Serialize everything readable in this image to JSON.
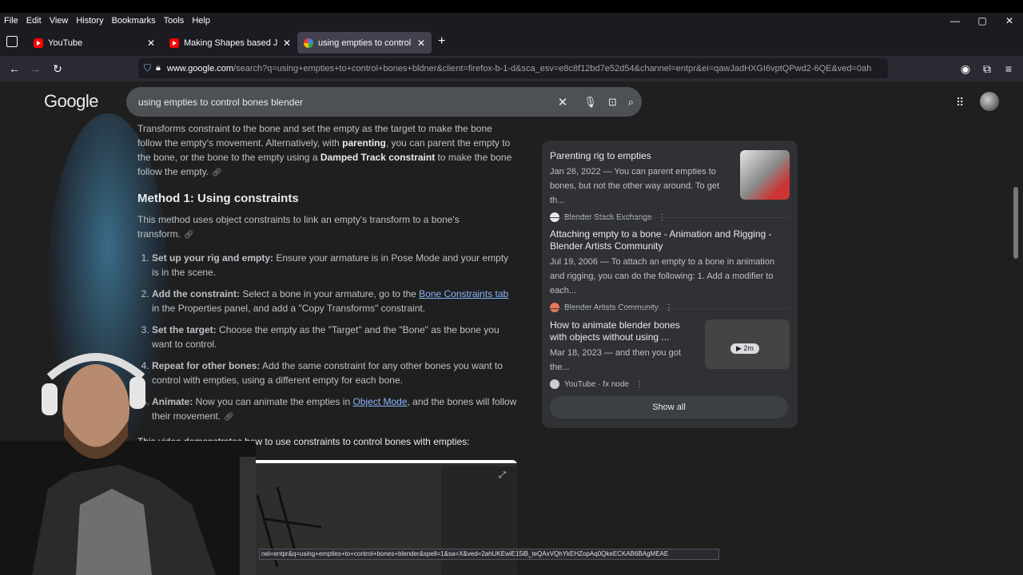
{
  "menubar": {
    "items": [
      "File",
      "Edit",
      "View",
      "History",
      "Bookmarks",
      "Tools",
      "Help"
    ]
  },
  "window_controls": [
    "—",
    "▢",
    "✕"
  ],
  "tabs": [
    {
      "label": "YouTube",
      "icon": "youtube-icon",
      "active": false
    },
    {
      "label": "Making Shapes based JIGGLE C",
      "icon": "youtube-icon",
      "active": false
    },
    {
      "label": "using empties to control bones",
      "icon": "google-icon",
      "active": true
    }
  ],
  "new_tab_label": "+",
  "address": {
    "domain": "www.google.com",
    "path": "/search?q=using+empties+to+control+bones+bldner&client=firefox-b-1-d&sca_esv=e8c8f12bd7e52d54&channel=entpr&ei=qawJadHXGI6vptQPwd2-6QE&ved=0ah"
  },
  "google": {
    "logo": "Google",
    "query": "using empties to control bones blender"
  },
  "article": {
    "p1_a": "Transforms constraint to the bone and set the empty as the target to make the bone follow the empty's movement. Alternatively, with ",
    "p1_b": "parenting",
    "p1_c": ", you can parent the empty to the bone, or the bone to the empty using a ",
    "p1_d": "Damped Track constraint",
    "p1_e": " to make the bone follow the empty.",
    "heading": "Method 1: Using constraints",
    "p2": "This method uses object constraints to link an empty's transform to a bone's transform.",
    "steps": [
      {
        "b": "Set up your rig and empty:",
        "t": " Ensure your armature is in Pose Mode and your empty is in the scene."
      },
      {
        "b": "Add the constraint:",
        "t1": " Select a bone in your armature, go to the ",
        "link": "Bone Constraints tab",
        "t2": " in the Properties panel, and add a \"Copy Transforms\" constraint."
      },
      {
        "b": "Set the target:",
        "t": " Choose the empty as the \"Target\" and the \"Bone\" as the bone you want to control."
      },
      {
        "b": "Repeat for other bones:",
        "t": " Add the same constraint for any other bones you want to control with empties, using a different empty for each bone."
      },
      {
        "b": "Animate:",
        "t1": " Now you can animate the empties in ",
        "link": "Object Mode",
        "t2": ", and the bones will follow their movement."
      }
    ],
    "video_caption": "This video demonstrates how to use constraints to control bones with empties:"
  },
  "sources": [
    {
      "title": "Parenting rig to empties",
      "snippet": "Jan 26, 2022 — You can parent empties to bones, but not the other way around. To get th...",
      "site": "Blender Stack Exchange"
    },
    {
      "title": "Attaching empty to a bone - Animation and Rigging - Blender Artists Community",
      "snippet": "Jul 19, 2006 — To attach an empty to a bone in animation and rigging, you can do the following: 1. Add a modifier to each...",
      "site": "Blender Artists Community"
    },
    {
      "title": "How to animate blender bones with objects without using ...",
      "snippet": "Mar 18, 2023 — and then you got the...",
      "site": "YouTube · fx node",
      "duration": "2m"
    }
  ],
  "show_all": "Show all",
  "status_url": "nel=entpr&q=using+empties+to+control+bones+blender&spell=1&sa=X&ved=2ahUKEwiE15iB_teQAxVQhYkEHZopAq0QkeECKAB6BAgMEAE",
  "colors": {
    "accent": "#8ab4f8",
    "bg": "#1f1f1f",
    "panel": "#303134"
  }
}
